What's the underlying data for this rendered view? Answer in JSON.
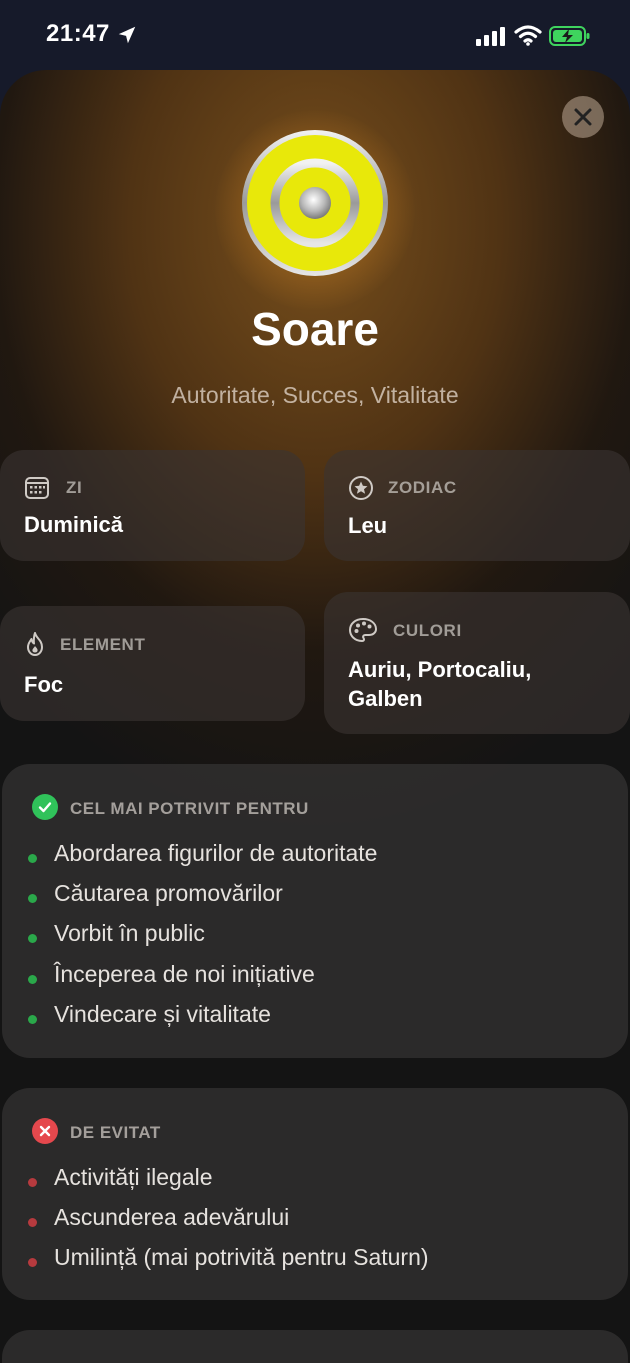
{
  "status_bar": {
    "time": "21:47"
  },
  "planet": {
    "name": "Soare",
    "keywords": "Autoritate, Succes, Vitalitate"
  },
  "info": {
    "day": {
      "label": "ZI",
      "value": "Duminică",
      "icon": "calendar-icon"
    },
    "zodiac": {
      "label": "ZODIAC",
      "value": "Leu",
      "icon": "star-circle-icon"
    },
    "element": {
      "label": "ELEMENT",
      "value": "Foc",
      "icon": "flame-icon"
    },
    "colors": {
      "label": "CULORI",
      "value_line1": "Auriu, Portocaliu,",
      "value_line2": "Galben",
      "icon": "palette-icon"
    }
  },
  "best_for": {
    "title": "CEL MAI POTRIVIT PENTRU",
    "accent": "#30c25a",
    "items": [
      "Abordarea figurilor de autoritate",
      "Căutarea promovărilor",
      "Vorbit în public",
      "Începerea de noi inițiative",
      "Vindecare și vitalitate"
    ]
  },
  "avoid": {
    "title": "DE EVITAT",
    "accent": "#e5484d",
    "items": [
      "Activități ilegale",
      "Ascunderea adevărului",
      "Umilință (mai potrivită pentru Saturn)"
    ]
  }
}
